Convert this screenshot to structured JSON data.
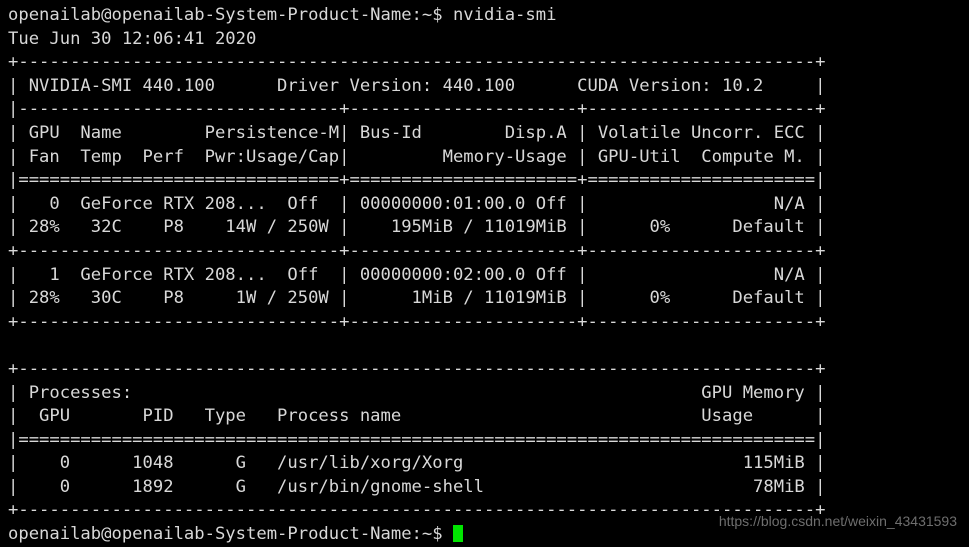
{
  "terminal": {
    "background_color": "#000000",
    "text_color": "#d8d8d8",
    "cursor_color": "#00e500",
    "prompt": "openailab@openailab-System-Product-Name:~$",
    "command": "nvidia-smi",
    "command_line": "openailab@openailab-System-Product-Name:~$ nvidia-smi",
    "timestamp": "Tue Jun 30 12:06:41 2020",
    "final_prompt": "openailab@openailab-System-Product-Name:~$ "
  },
  "nvidia_smi": {
    "header": {
      "smi_version_label": "NVIDIA-SMI",
      "smi_version": "440.100",
      "driver_version_label": "Driver Version:",
      "driver_version": "440.100",
      "cuda_version_label": "CUDA Version:",
      "cuda_version": "10.2"
    },
    "column_headers_row1": [
      "GPU",
      "Name",
      "Persistence-M",
      "Bus-Id",
      "Disp.A",
      "Volatile Uncorr. ECC"
    ],
    "column_headers_row2": [
      "Fan",
      "Temp",
      "Perf",
      "Pwr:Usage/Cap",
      "Memory-Usage",
      "GPU-Util",
      "Compute M."
    ],
    "gpus": [
      {
        "index": "0",
        "name": "GeForce RTX 208...",
        "persistence_m": "Off",
        "bus_id": "00000000:01:00.0",
        "disp_a": "Off",
        "ecc": "N/A",
        "fan": "28%",
        "temp": "32C",
        "perf": "P8",
        "pwr_usage": "14W",
        "pwr_cap": "250W",
        "memory_used": "195MiB",
        "memory_total": "11019MiB",
        "gpu_util": "0%",
        "compute_m": "Default"
      },
      {
        "index": "1",
        "name": "GeForce RTX 208...",
        "persistence_m": "Off",
        "bus_id": "00000000:02:00.0",
        "disp_a": "Off",
        "ecc": "N/A",
        "fan": "28%",
        "temp": "30C",
        "perf": "P8",
        "pwr_usage": "1W",
        "pwr_cap": "250W",
        "memory_used": "1MiB",
        "memory_total": "11019MiB",
        "gpu_util": "0%",
        "compute_m": "Default"
      }
    ],
    "processes": {
      "section_title": "Processes:",
      "column_headers": [
        "GPU",
        "PID",
        "Type",
        "Process name",
        "GPU Memory",
        "Usage"
      ],
      "rows": [
        {
          "gpu": "0",
          "pid": "1048",
          "type": "G",
          "process_name": "/usr/lib/xorg/Xorg",
          "memory": "115MiB"
        },
        {
          "gpu": "0",
          "pid": "1892",
          "type": "G",
          "process_name": "/usr/bin/gnome-shell",
          "memory": "78MiB"
        }
      ]
    }
  },
  "lines": [
    "openailab@openailab-System-Product-Name:~$ nvidia-smi",
    "Tue Jun 30 12:06:41 2020",
    "+-----------------------------------------------------------------------------+",
    "| NVIDIA-SMI 440.100      Driver Version: 440.100      CUDA Version: 10.2     |",
    "|-------------------------------+----------------------+----------------------+",
    "| GPU  Name        Persistence-M| Bus-Id        Disp.A | Volatile Uncorr. ECC |",
    "| Fan  Temp  Perf  Pwr:Usage/Cap|         Memory-Usage | GPU-Util  Compute M. |",
    "|===============================+======================+======================|",
    "|   0  GeForce RTX 208...  Off  | 00000000:01:00.0 Off |                  N/A |",
    "| 28%   32C    P8    14W / 250W |    195MiB / 11019MiB |      0%      Default |",
    "+-------------------------------+----------------------+----------------------+",
    "|   1  GeForce RTX 208...  Off  | 00000000:02:00.0 Off |                  N/A |",
    "| 28%   30C    P8     1W / 250W |      1MiB / 11019MiB |      0%      Default |",
    "+-------------------------------+----------------------+----------------------+",
    "",
    "+-----------------------------------------------------------------------------+",
    "| Processes:                                                       GPU Memory |",
    "|  GPU       PID   Type   Process name                             Usage      |",
    "|=============================================================================|",
    "|    0      1048      G   /usr/lib/xorg/Xorg                           115MiB |",
    "|    0      1892      G   /usr/bin/gnome-shell                          78MiB |",
    "+-----------------------------------------------------------------------------+"
  ],
  "watermark": {
    "text": "https://blog.csdn.net/weixin_43431593"
  }
}
